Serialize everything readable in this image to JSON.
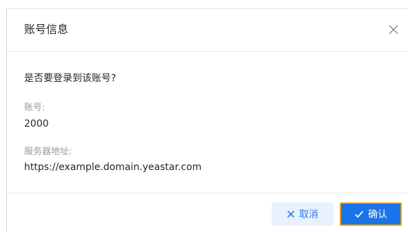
{
  "dialog": {
    "title": "账号信息",
    "question": "是否要登录到该账号?",
    "account_label": "账号:",
    "account_value": "2000",
    "server_label": "服务器地址:",
    "server_value": "https://example.domain.yeastar.com"
  },
  "footer": {
    "cancel_label": "取消",
    "confirm_label": "确认"
  },
  "icons": {
    "close": "close-icon",
    "cancel": "x-icon",
    "confirm": "check-icon"
  },
  "colors": {
    "primary": "#1a73e8",
    "cancel_bg": "#e8f2ff",
    "focus_outline": "#f0a000"
  }
}
